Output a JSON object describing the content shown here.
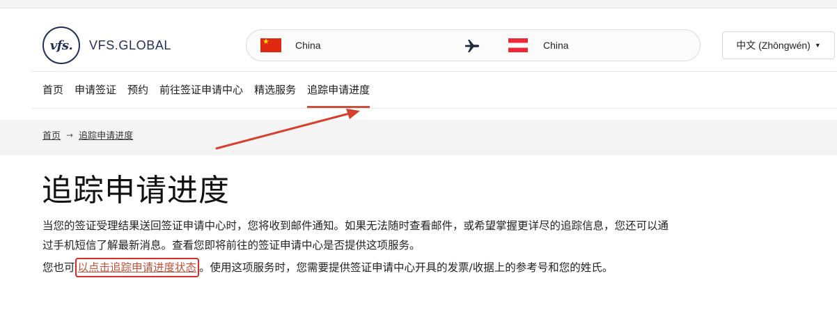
{
  "header": {
    "logo_mark": "vfs.",
    "logo_text": "VFS.GLOBAL",
    "route": {
      "origin": "China",
      "destination": "China",
      "origin_flag": "china-flag",
      "destination_flag": "austria-flag",
      "separator_icon": "airplane-icon"
    },
    "language": {
      "label": "中文 (Zhōngwén)",
      "icon": "caret-down-icon"
    }
  },
  "nav": {
    "items": [
      {
        "label": "首页"
      },
      {
        "label": "申请签证"
      },
      {
        "label": "预约"
      },
      {
        "label": "前往签证申请中心"
      },
      {
        "label": "精选服务"
      },
      {
        "label": "追踪申请进度"
      }
    ],
    "active_index": 5
  },
  "breadcrumb": {
    "home": "首页",
    "current": "追踪申请进度"
  },
  "main": {
    "title": "追踪申请进度",
    "paragraph_1": "当您的签证受理结果送回签证申请中心时，您将收到邮件通知。如果无法随时查看邮件，或希望掌握更详尽的追踪信息，您还可以通过手机短信了解最新消息。查看您即将前往的签证申请中心是否提供这项服务。",
    "paragraph_2_before": "您也可",
    "paragraph_2_link": "以点击追踪申请进度状态",
    "paragraph_2_after": "。使用这项服务时，您需要提供签证申请中心开具的发票/收据上的参考号和您的姓氏。"
  },
  "colors": {
    "accent": "#c7523b",
    "brand": "#1f2f57",
    "annotation": "#d42b2b"
  }
}
